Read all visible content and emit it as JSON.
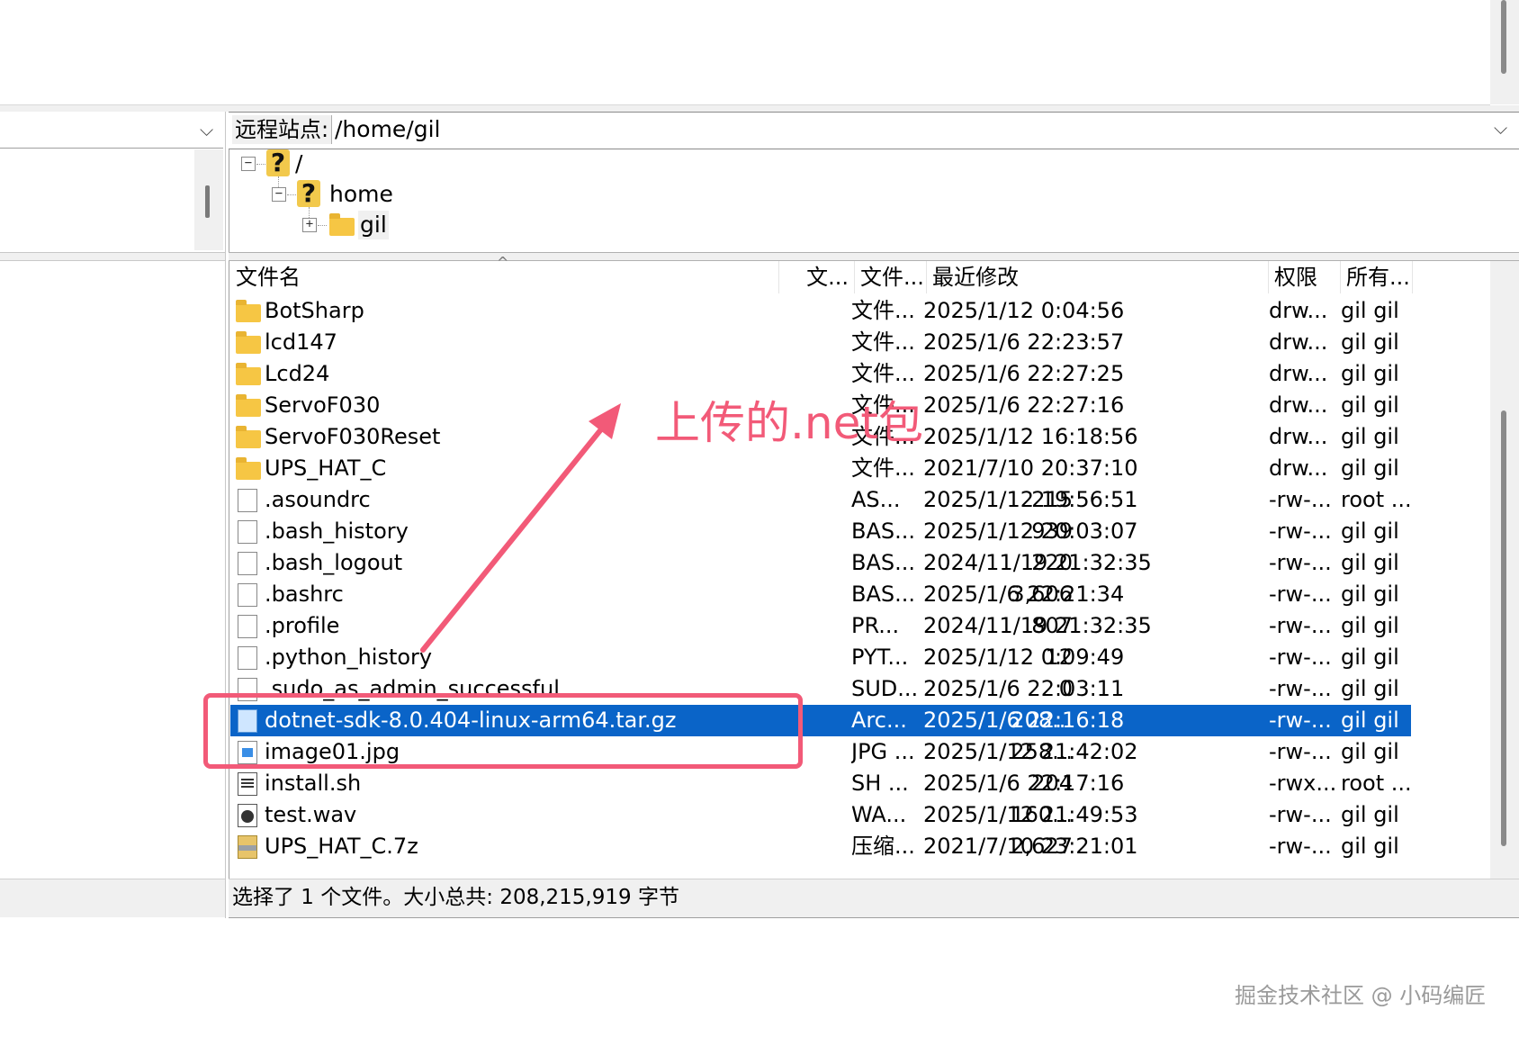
{
  "remote": {
    "label": "远程站点:",
    "path": "/home/gil"
  },
  "tree": [
    {
      "label": "/",
      "toggle": "−"
    },
    {
      "label": "home",
      "toggle": "−"
    },
    {
      "label": "gil",
      "toggle": "+"
    }
  ],
  "list": {
    "columns": [
      "文件名",
      "文...",
      "文件...",
      "最近修改",
      "权限",
      "所有..."
    ],
    "rows": [
      {
        "name": "BotSharp",
        "size": "",
        "type": "文件...",
        "date": "2025/1/12 0:04:56",
        "perm": "drw...",
        "owner": "gil gil",
        "icon": "folder-icon"
      },
      {
        "name": "lcd147",
        "size": "",
        "type": "文件...",
        "date": "2025/1/6 22:23:57",
        "perm": "drw...",
        "owner": "gil gil",
        "icon": "folder-icon"
      },
      {
        "name": "Lcd24",
        "size": "",
        "type": "文件...",
        "date": "2025/1/6 22:27:25",
        "perm": "drw...",
        "owner": "gil gil",
        "icon": "folder-icon"
      },
      {
        "name": "ServoF030",
        "size": "",
        "type": "文件...",
        "date": "2025/1/6 22:27:16",
        "perm": "drw...",
        "owner": "gil gil",
        "icon": "folder-icon"
      },
      {
        "name": "ServoF030Reset",
        "size": "",
        "type": "文件...",
        "date": "2025/1/12 16:18:56",
        "perm": "drw...",
        "owner": "gil gil",
        "icon": "folder-icon"
      },
      {
        "name": "UPS_HAT_C",
        "size": "",
        "type": "文件...",
        "date": "2021/7/10 20:37:10",
        "perm": "drw...",
        "owner": "gil gil",
        "icon": "folder-icon"
      },
      {
        "name": ".asoundrc",
        "size": "215",
        "type": "AS...",
        "date": "2025/1/12 19:56:51",
        "perm": "-rw-...",
        "owner": "root ...",
        "icon": "file-icon"
      },
      {
        "name": ".bash_history",
        "size": "939",
        "type": "BAS...",
        "date": "2025/1/12 20:03:07",
        "perm": "-rw-...",
        "owner": "gil gil",
        "icon": "file-icon"
      },
      {
        "name": ".bash_logout",
        "size": "220",
        "type": "BAS...",
        "date": "2024/11/19 21:32:35",
        "perm": "-rw-...",
        "owner": "gil gil",
        "icon": "file-icon"
      },
      {
        "name": ".bashrc",
        "size": "3,606",
        "type": "BAS...",
        "date": "2025/1/6 22:21:34",
        "perm": "-rw-...",
        "owner": "gil gil",
        "icon": "file-icon"
      },
      {
        "name": ".profile",
        "size": "807",
        "type": "PR...",
        "date": "2024/11/19 21:32:35",
        "perm": "-rw-...",
        "owner": "gil gil",
        "icon": "file-icon"
      },
      {
        "name": ".python_history",
        "size": "12",
        "type": "PYT...",
        "date": "2025/1/12 0:09:49",
        "perm": "-rw-...",
        "owner": "gil gil",
        "icon": "file-icon"
      },
      {
        "name": ".sudo_as_admin_successful",
        "size": "0",
        "type": "SUD...",
        "date": "2025/1/6 22:03:11",
        "perm": "-rw-...",
        "owner": "gil gil",
        "icon": "file-icon"
      },
      {
        "name": "dotnet-sdk-8.0.404-linux-arm64.tar.gz",
        "size": "208...",
        "type": "Arc...",
        "date": "2025/1/6 22:16:18",
        "perm": "-rw-...",
        "owner": "gil gil",
        "icon": "archive-file-icon",
        "selected": true
      },
      {
        "name": "image01.jpg",
        "size": "258...",
        "type": "JPG ...",
        "date": "2025/1/12 21:42:02",
        "perm": "-rw-...",
        "owner": "gil gil",
        "icon": "image-file-icon"
      },
      {
        "name": "install.sh",
        "size": "204",
        "type": "SH ...",
        "date": "2025/1/6 22:17:16",
        "perm": "-rwx...",
        "owner": "root ...",
        "icon": "script-file-icon"
      },
      {
        "name": "test.wav",
        "size": "160...",
        "type": "WA...",
        "date": "2025/1/12 21:49:53",
        "perm": "-rw-...",
        "owner": "gil gil",
        "icon": "audio-file-icon"
      },
      {
        "name": "UPS_HAT_C.7z",
        "size": "2,627",
        "type": "压缩...",
        "date": "2021/7/10 23:21:01",
        "perm": "-rw-...",
        "owner": "gil gil",
        "icon": "7z-archive-icon"
      }
    ]
  },
  "status": {
    "text": "选择了 1 个文件。大小总共: 208,215,919 字节"
  },
  "annotation": {
    "text": "上传的.net包",
    "color": "#f25a78"
  },
  "watermark": "掘金技术社区 @ 小码编匠",
  "colors": {
    "selection": "#0a64c8",
    "folder": "#f6c644"
  }
}
